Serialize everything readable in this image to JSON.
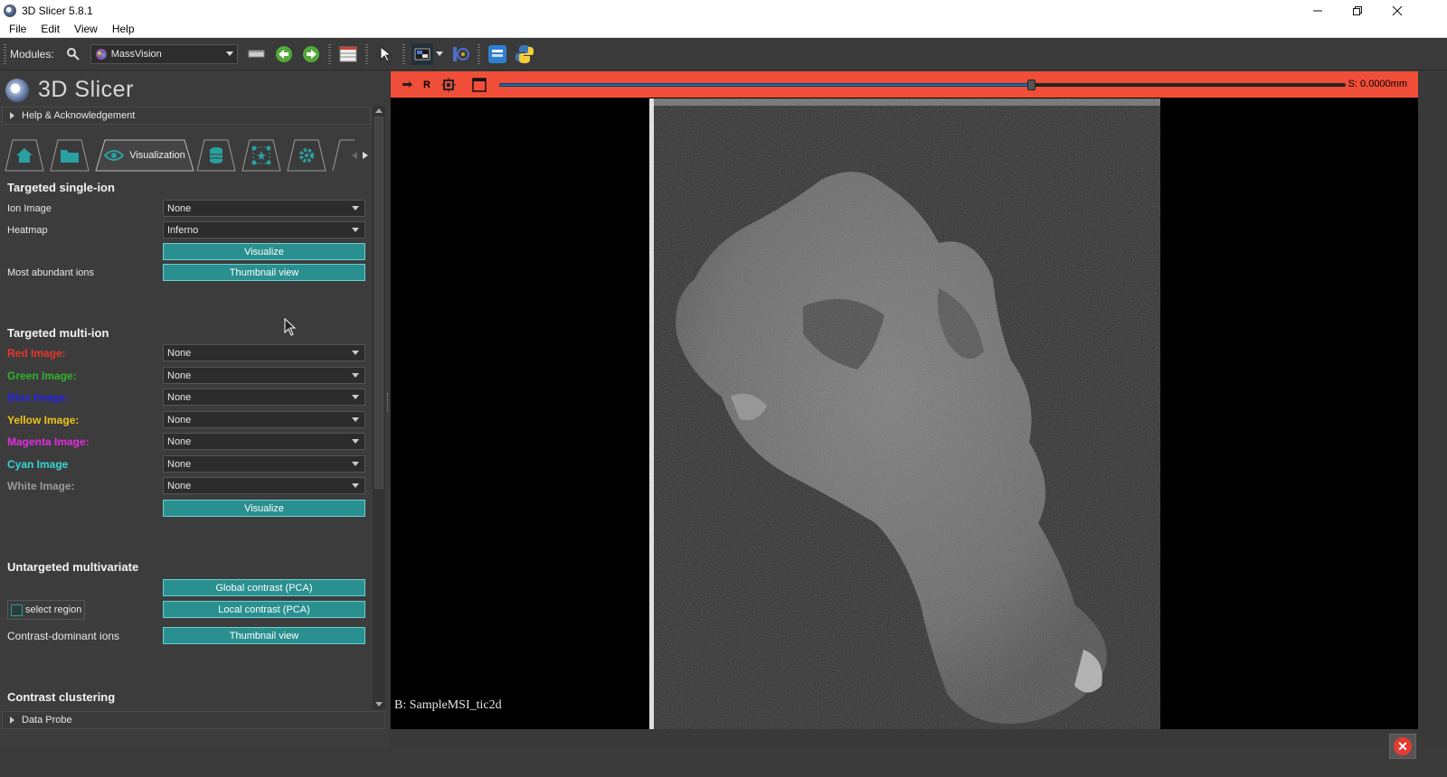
{
  "window": {
    "title": "3D Slicer 5.8.1"
  },
  "menu": {
    "file": "File",
    "edit": "Edit",
    "view": "View",
    "help": "Help"
  },
  "toolbar": {
    "modules_label": "Modules:",
    "module_selected": "MassVision"
  },
  "brand": {
    "name": "3D Slicer"
  },
  "panel": {
    "help_ack": "Help & Acknowledgement",
    "data_probe": "Data Probe",
    "active_tab": "Visualization",
    "tab_icons": [
      "home-icon",
      "folder-icon",
      "eye-icon",
      "database-icon",
      "network-icon",
      "gear-icon"
    ]
  },
  "single_ion": {
    "title": "Targeted single-ion",
    "ion_image_label": "Ion Image",
    "ion_image_value": "None",
    "heatmap_label": "Heatmap",
    "heatmap_value": "Inferno",
    "visualize": "Visualize",
    "abundant_label": "Most abundant ions",
    "thumbnail": "Thumbnail view"
  },
  "multi_ion": {
    "title": "Targeted multi-ion",
    "channels": [
      {
        "label": "Red Image:",
        "value": "None",
        "color": "#e8372c"
      },
      {
        "label": "Green Image:",
        "value": "None",
        "color": "#2fb52f"
      },
      {
        "label": "Blue Image:",
        "value": "None",
        "color": "#2424e6"
      },
      {
        "label": "Yellow Image:",
        "value": "None",
        "color": "#f0c419"
      },
      {
        "label": "Magenta Image:",
        "value": "None",
        "color": "#e22ce2"
      },
      {
        "label": "Cyan Image",
        "value": "None",
        "color": "#36d7d7"
      },
      {
        "label": "White Image:",
        "value": "None",
        "color": "#9a9a9a"
      }
    ],
    "visualize": "Visualize"
  },
  "untargeted": {
    "title": "Untargeted multivariate",
    "global_pca": "Global contrast (PCA)",
    "select_region": "select region",
    "local_pca": "Local contrast (PCA)",
    "dominant_label": "Contrast-dominant ions",
    "thumbnail": "Thumbnail view"
  },
  "clustering": {
    "title": "Contrast clustering"
  },
  "slice": {
    "orientation": "R",
    "offset": "S: 0.0000mm",
    "label": "B: SampleMSI_tic2d",
    "bar_color": "#f04e38"
  }
}
